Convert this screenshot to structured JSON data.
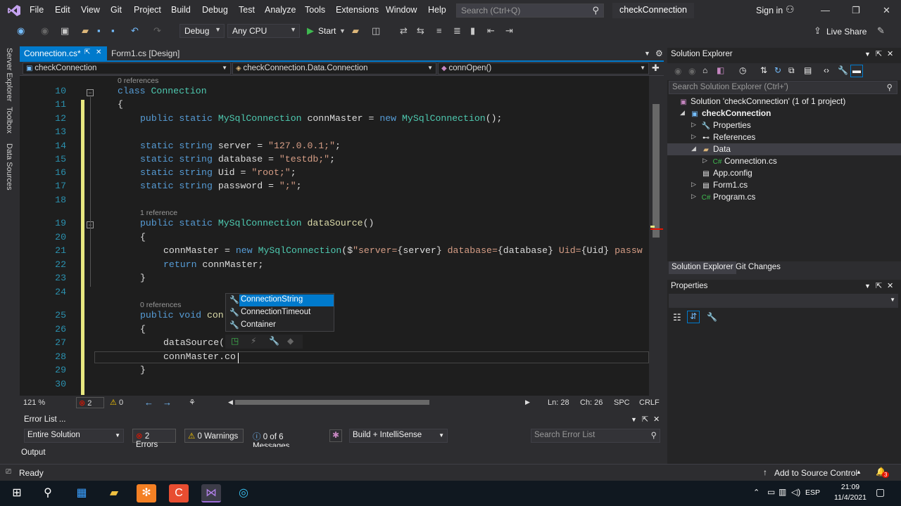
{
  "menubar": {
    "items": [
      "File",
      "Edit",
      "View",
      "Git",
      "Project",
      "Build",
      "Debug",
      "Test",
      "Analyze",
      "Tools",
      "Extensions",
      "Window",
      "Help"
    ],
    "search_placeholder": "Search (Ctrl+Q)",
    "solution_title": "checkConnection",
    "signin": "Sign in"
  },
  "toolbar": {
    "config": "Debug",
    "platform": "Any CPU",
    "start": "Start",
    "live_share": "Live Share"
  },
  "side_tabs": [
    "Server Explorer",
    "Toolbox",
    "Data Sources"
  ],
  "editor": {
    "tabs": [
      {
        "label": "Connection.cs*",
        "active": true
      },
      {
        "label": "Form1.cs [Design]",
        "active": false
      }
    ],
    "nav": {
      "project": "checkConnection",
      "class": "checkConnection.Data.Connection",
      "member": "connOpen()"
    },
    "codelens": {
      "l10": "0 references",
      "l19": "1 reference",
      "l25": "0 references"
    },
    "lines": {
      "n10": "10",
      "n11": "11",
      "n12": "12",
      "n13": "13",
      "n14": "14",
      "n15": "15",
      "n16": "16",
      "n17": "17",
      "n18": "18",
      "n19": "19",
      "n20": "20",
      "n21": "21",
      "n22": "22",
      "n23": "23",
      "n24": "24",
      "n25": "25",
      "n26": "26",
      "n27": "27",
      "n28": "28",
      "n29": "29",
      "n30": "30",
      "l10_kw": "class",
      "l10_ty": "Connection",
      "l11": "{",
      "l12_kw": "public static",
      "l12_ty": "MySqlConnection",
      "l12_f": "connMaster =",
      "l12_kw2": "new",
      "l12_ty2": "MySqlConnection",
      "l12_end": "();",
      "l14_kw": "static string",
      "l14_f": "server =",
      "l14_s": "\"127.0.0.1;\"",
      "l14_e": ";",
      "l15_kw": "static string",
      "l15_f": "database =",
      "l15_s": "\"testdb;\"",
      "l15_e": ";",
      "l16_kw": "static string",
      "l16_f": "Uid =",
      "l16_s": "\"root;\"",
      "l16_e": ";",
      "l17_kw": "static string",
      "l17_f": "password =",
      "l17_s": "\";\"",
      "l17_e": ";",
      "l19_kw": "public static",
      "l19_ty": "MySqlConnection",
      "l19_m": "dataSource",
      "l19_e": "()",
      "l20": "{",
      "l21_f": "connMaster =",
      "l21_kw": "new",
      "l21_ty": "MySqlConnection",
      "l21_p": "($",
      "l21_s": "\"server=",
      "l21_i1": "{server}",
      "l21_s2": " database=",
      "l21_i2": "{database}",
      "l21_s3": " Uid=",
      "l21_i3": "{Uid}",
      "l21_s4": " passw",
      "l22_kw": "return",
      "l22_f": "connMaster;",
      "l23": "}",
      "l25_kw": "public void",
      "l25_m": "con",
      "l26": "{",
      "l27_m": "dataSource(",
      "l28": "connMaster.co",
      "l29": "}"
    },
    "autocomplete": [
      "ConnectionString",
      "ConnectionTimeout",
      "Container"
    ],
    "status": {
      "zoom": "121 %",
      "errors": "2",
      "warnings": "0",
      "line": "Ln: 28",
      "col": "Ch: 26",
      "spc": "SPC",
      "crlf": "CRLF"
    }
  },
  "error_list": {
    "title": "Error List ...",
    "scope": "Entire Solution",
    "errors": "2 Errors",
    "warnings": "0 Warnings",
    "messages": "0 of 6 Messages",
    "source": "Build + IntelliSense",
    "search": "Search Error List"
  },
  "output_tab": "Output",
  "solution_explorer": {
    "title": "Solution Explorer",
    "search": "Search Solution Explorer (Ctrl+')",
    "nodes": [
      {
        "label": "Solution 'checkConnection' (1 of 1 project)"
      },
      {
        "label": "checkConnection"
      },
      {
        "label": "Properties"
      },
      {
        "label": "References"
      },
      {
        "label": "Data"
      },
      {
        "label": "Connection.cs"
      },
      {
        "label": "App.config"
      },
      {
        "label": "Form1.cs"
      },
      {
        "label": "Program.cs"
      }
    ],
    "tabs": [
      "Solution Explorer",
      "Git Changes"
    ]
  },
  "properties": {
    "title": "Properties"
  },
  "statusbar": {
    "ready": "Ready",
    "source_control": "Add to Source Control",
    "notif": "3"
  },
  "taskbar": {
    "lang": "ESP",
    "time": "21:09",
    "date": "11/4/2021"
  },
  "colors": {
    "accent": "#007acc",
    "error": "#e51400",
    "changebar": "#e8e880"
  }
}
